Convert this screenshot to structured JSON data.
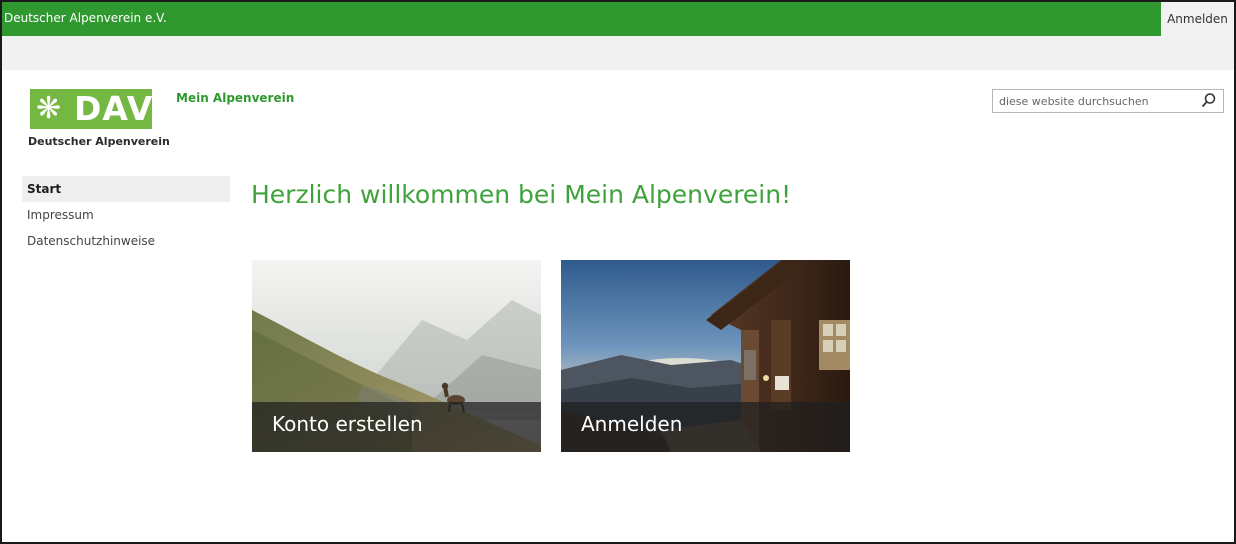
{
  "suite_bar": {
    "brand": "Deutscher Alpenverein e.V.",
    "sign_in": "Anmelden"
  },
  "header": {
    "logo_text": "DAV",
    "logo_subtitle": "Deutscher Alpenverein",
    "site_title": "Mein Alpenverein"
  },
  "search": {
    "placeholder": "diese website durchsuchen",
    "icon": "search-icon"
  },
  "quick_launch": {
    "items": [
      {
        "label": "Start",
        "active": true
      },
      {
        "label": "Impressum",
        "active": false
      },
      {
        "label": "Datenschutzhinweise",
        "active": false
      }
    ]
  },
  "main": {
    "heading": "Herzlich willkommen bei Mein Alpenverein!",
    "tiles": [
      {
        "label": "Konto erstellen"
      },
      {
        "label": "Anmelden"
      }
    ]
  },
  "colors": {
    "suite_bar": "#2f9930",
    "accent_green": "#3fa33b",
    "logo_green": "#74b843"
  }
}
